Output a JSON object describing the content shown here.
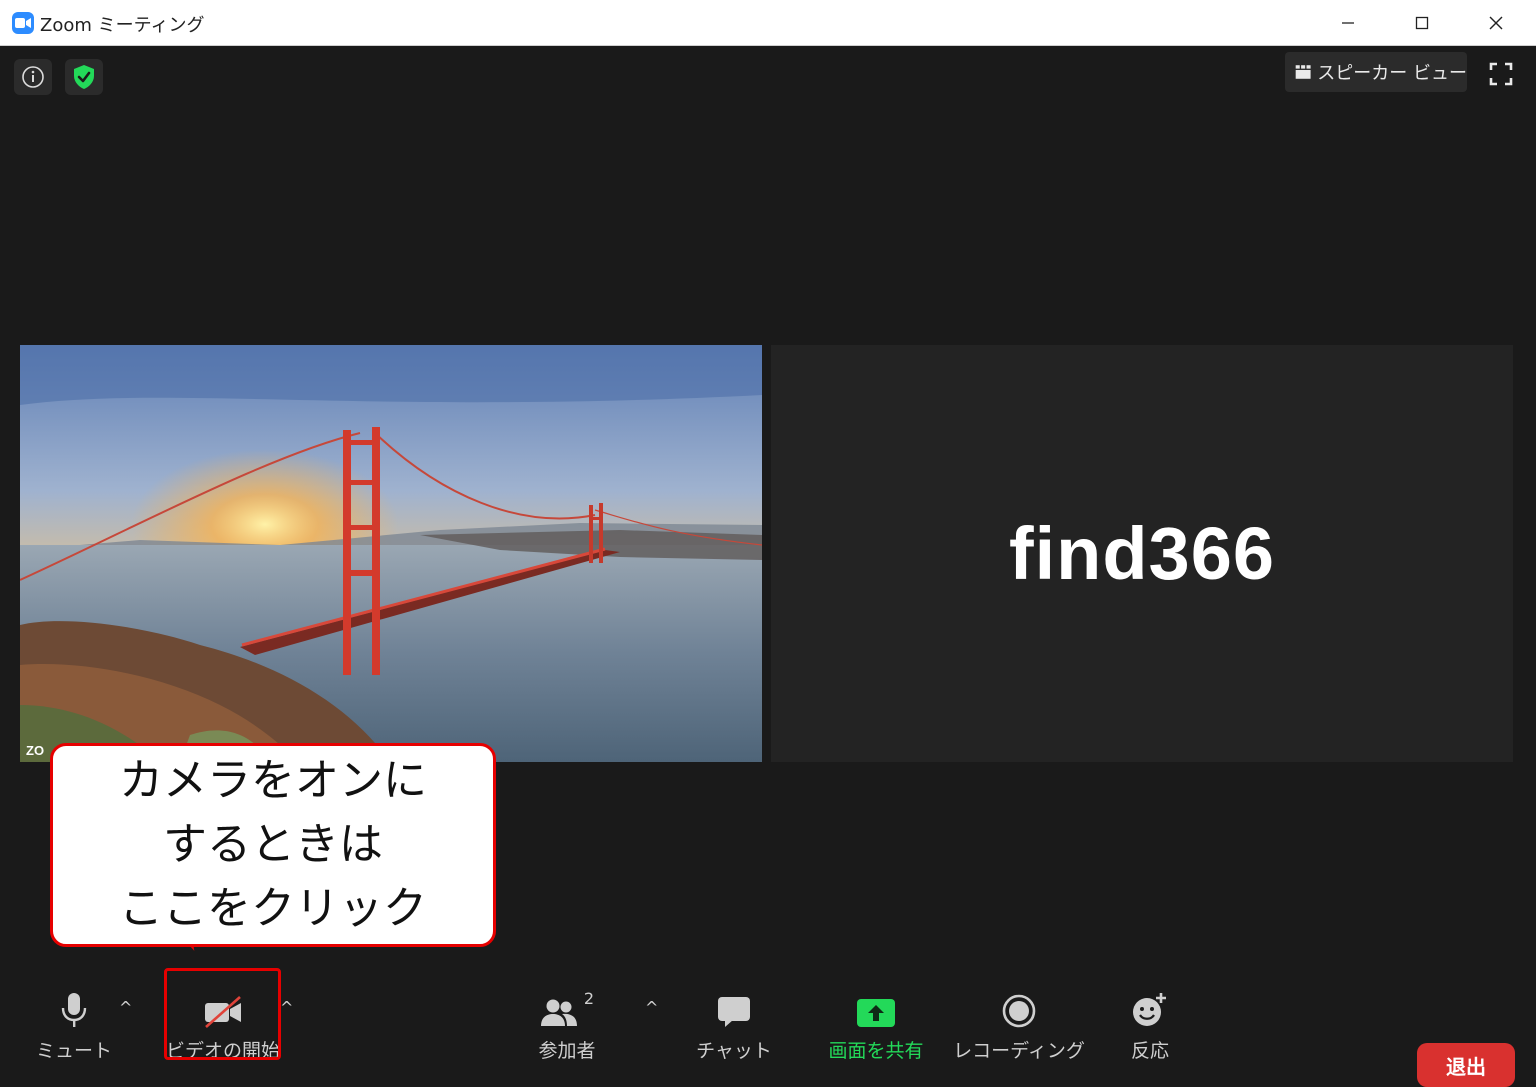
{
  "window": {
    "title": "Zoom ミーティング",
    "controls": [
      "minimize",
      "maximize",
      "close"
    ]
  },
  "top_bar": {
    "view_button_label": "スピーカー ビュー"
  },
  "tiles": {
    "left_label": "ZO",
    "right_participant_name": "find366"
  },
  "callout": {
    "lines": [
      "カメラをオンに",
      "するときは",
      "ここをクリック"
    ]
  },
  "toolbar": {
    "mute_label": "ミュート",
    "video_label": "ビデオの開始",
    "participants_label": "参加者",
    "participants_count": "2",
    "chat_label": "チャット",
    "share_label": "画面を共有",
    "record_label": "レコーディング",
    "reactions_label": "反応",
    "leave_label": "退出",
    "caret": "^"
  },
  "colors": {
    "accent_blue": "#2d8cff",
    "share_green": "#23d959",
    "leave_red": "#d9312f",
    "callout_border": "#e60000"
  }
}
